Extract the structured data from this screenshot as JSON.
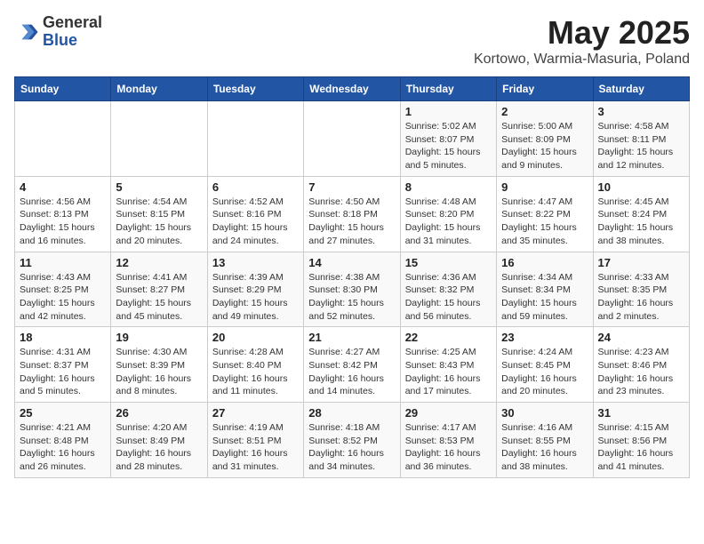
{
  "header": {
    "logo_general": "General",
    "logo_blue": "Blue",
    "month_title": "May 2025",
    "location": "Kortowo, Warmia-Masuria, Poland"
  },
  "days_of_week": [
    "Sunday",
    "Monday",
    "Tuesday",
    "Wednesday",
    "Thursday",
    "Friday",
    "Saturday"
  ],
  "weeks": [
    [
      {
        "num": "",
        "detail": ""
      },
      {
        "num": "",
        "detail": ""
      },
      {
        "num": "",
        "detail": ""
      },
      {
        "num": "",
        "detail": ""
      },
      {
        "num": "1",
        "detail": "Sunrise: 5:02 AM\nSunset: 8:07 PM\nDaylight: 15 hours\nand 5 minutes."
      },
      {
        "num": "2",
        "detail": "Sunrise: 5:00 AM\nSunset: 8:09 PM\nDaylight: 15 hours\nand 9 minutes."
      },
      {
        "num": "3",
        "detail": "Sunrise: 4:58 AM\nSunset: 8:11 PM\nDaylight: 15 hours\nand 12 minutes."
      }
    ],
    [
      {
        "num": "4",
        "detail": "Sunrise: 4:56 AM\nSunset: 8:13 PM\nDaylight: 15 hours\nand 16 minutes."
      },
      {
        "num": "5",
        "detail": "Sunrise: 4:54 AM\nSunset: 8:15 PM\nDaylight: 15 hours\nand 20 minutes."
      },
      {
        "num": "6",
        "detail": "Sunrise: 4:52 AM\nSunset: 8:16 PM\nDaylight: 15 hours\nand 24 minutes."
      },
      {
        "num": "7",
        "detail": "Sunrise: 4:50 AM\nSunset: 8:18 PM\nDaylight: 15 hours\nand 27 minutes."
      },
      {
        "num": "8",
        "detail": "Sunrise: 4:48 AM\nSunset: 8:20 PM\nDaylight: 15 hours\nand 31 minutes."
      },
      {
        "num": "9",
        "detail": "Sunrise: 4:47 AM\nSunset: 8:22 PM\nDaylight: 15 hours\nand 35 minutes."
      },
      {
        "num": "10",
        "detail": "Sunrise: 4:45 AM\nSunset: 8:24 PM\nDaylight: 15 hours\nand 38 minutes."
      }
    ],
    [
      {
        "num": "11",
        "detail": "Sunrise: 4:43 AM\nSunset: 8:25 PM\nDaylight: 15 hours\nand 42 minutes."
      },
      {
        "num": "12",
        "detail": "Sunrise: 4:41 AM\nSunset: 8:27 PM\nDaylight: 15 hours\nand 45 minutes."
      },
      {
        "num": "13",
        "detail": "Sunrise: 4:39 AM\nSunset: 8:29 PM\nDaylight: 15 hours\nand 49 minutes."
      },
      {
        "num": "14",
        "detail": "Sunrise: 4:38 AM\nSunset: 8:30 PM\nDaylight: 15 hours\nand 52 minutes."
      },
      {
        "num": "15",
        "detail": "Sunrise: 4:36 AM\nSunset: 8:32 PM\nDaylight: 15 hours\nand 56 minutes."
      },
      {
        "num": "16",
        "detail": "Sunrise: 4:34 AM\nSunset: 8:34 PM\nDaylight: 15 hours\nand 59 minutes."
      },
      {
        "num": "17",
        "detail": "Sunrise: 4:33 AM\nSunset: 8:35 PM\nDaylight: 16 hours\nand 2 minutes."
      }
    ],
    [
      {
        "num": "18",
        "detail": "Sunrise: 4:31 AM\nSunset: 8:37 PM\nDaylight: 16 hours\nand 5 minutes."
      },
      {
        "num": "19",
        "detail": "Sunrise: 4:30 AM\nSunset: 8:39 PM\nDaylight: 16 hours\nand 8 minutes."
      },
      {
        "num": "20",
        "detail": "Sunrise: 4:28 AM\nSunset: 8:40 PM\nDaylight: 16 hours\nand 11 minutes."
      },
      {
        "num": "21",
        "detail": "Sunrise: 4:27 AM\nSunset: 8:42 PM\nDaylight: 16 hours\nand 14 minutes."
      },
      {
        "num": "22",
        "detail": "Sunrise: 4:25 AM\nSunset: 8:43 PM\nDaylight: 16 hours\nand 17 minutes."
      },
      {
        "num": "23",
        "detail": "Sunrise: 4:24 AM\nSunset: 8:45 PM\nDaylight: 16 hours\nand 20 minutes."
      },
      {
        "num": "24",
        "detail": "Sunrise: 4:23 AM\nSunset: 8:46 PM\nDaylight: 16 hours\nand 23 minutes."
      }
    ],
    [
      {
        "num": "25",
        "detail": "Sunrise: 4:21 AM\nSunset: 8:48 PM\nDaylight: 16 hours\nand 26 minutes."
      },
      {
        "num": "26",
        "detail": "Sunrise: 4:20 AM\nSunset: 8:49 PM\nDaylight: 16 hours\nand 28 minutes."
      },
      {
        "num": "27",
        "detail": "Sunrise: 4:19 AM\nSunset: 8:51 PM\nDaylight: 16 hours\nand 31 minutes."
      },
      {
        "num": "28",
        "detail": "Sunrise: 4:18 AM\nSunset: 8:52 PM\nDaylight: 16 hours\nand 34 minutes."
      },
      {
        "num": "29",
        "detail": "Sunrise: 4:17 AM\nSunset: 8:53 PM\nDaylight: 16 hours\nand 36 minutes."
      },
      {
        "num": "30",
        "detail": "Sunrise: 4:16 AM\nSunset: 8:55 PM\nDaylight: 16 hours\nand 38 minutes."
      },
      {
        "num": "31",
        "detail": "Sunrise: 4:15 AM\nSunset: 8:56 PM\nDaylight: 16 hours\nand 41 minutes."
      }
    ]
  ]
}
